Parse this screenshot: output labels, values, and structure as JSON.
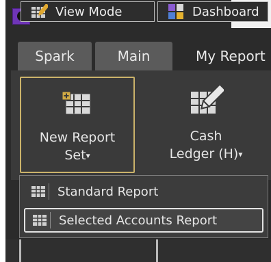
{
  "tabs": [
    {
      "label": "Spark"
    },
    {
      "label": "Main"
    },
    {
      "label": "My Report"
    }
  ],
  "ribbon": {
    "new_report_line1": "New Report",
    "new_report_line2": "Set",
    "cash_line1": "Cash",
    "cash_line2": "Ledger (H)"
  },
  "dropdown": {
    "items": [
      {
        "label": "Standard Report"
      },
      {
        "label": "Selected Accounts Report"
      }
    ]
  },
  "bottom": {
    "view_mode": "View Mode",
    "dashboard": "Dashboard"
  },
  "icons": {
    "app": "app-logo-icon",
    "new_report": "table-add-icon",
    "cash": "ledger-pencil-icon",
    "report_item": "table-icon",
    "view_mode": "view-mode-icon",
    "dashboard": "dashboard-icon"
  },
  "colors": {
    "accent_purple": "#6f35b8",
    "focus_gold": "#cbb36a"
  }
}
